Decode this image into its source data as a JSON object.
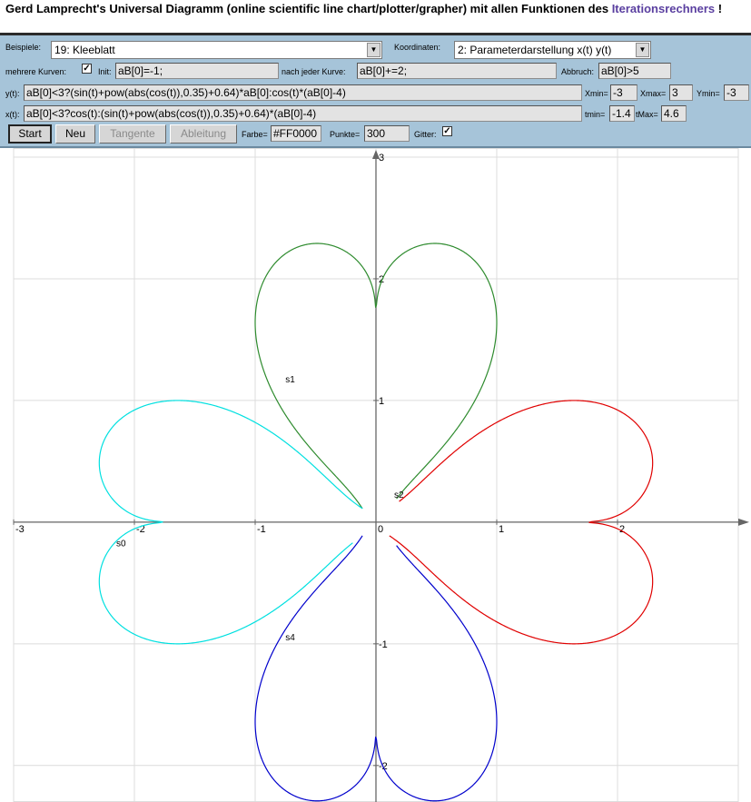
{
  "title": {
    "text": "Gerd Lamprecht's Universal Diagramm (online scientific line chart/plotter/grapher) mit allen Funktionen des ",
    "link": "Iterationsrechners",
    "suffix": " !"
  },
  "controls": {
    "examples_label": "Beispiele:",
    "examples_selected": "19: Kleeblatt",
    "coords_label": "Koordinaten:",
    "coords_selected": "2: Parameterdarstellung x(t) y(t)",
    "multi_label": "mehrere Kurven:",
    "multi_checked": "✓",
    "init_label": "Init:",
    "init_value": "aB[0]=-1;",
    "after_label": "nach jeder Kurve:",
    "after_value": "aB[0]+=2;",
    "abort_label": "Abbruch:",
    "abort_value": "aB[0]>5",
    "y_label": "y(t):",
    "y_value": "aB[0]<3?(sin(t)+pow(abs(cos(t)),0.35)+0.64)*aB[0]:cos(t)*(aB[0]-4)",
    "x_label": "x(t):",
    "x_value": "aB[0]<3?cos(t):(sin(t)+pow(abs(cos(t)),0.35)+0.64)*(aB[0]-4)",
    "xmin_label": "Xmin=",
    "xmin_value": "-3",
    "xmax_label": "Xmax=",
    "xmax_value": "3",
    "ymin_label": "Ymin=",
    "ymin_value": "-3",
    "tmin_label": "tmin=",
    "tmin_value": "-1.4",
    "tmax_label": "tMax=",
    "tmax_value": "4.6",
    "start_button": "Start",
    "new_button": "Neu",
    "tangent_button": "Tangente",
    "derivative_button": "Ableitung",
    "color_label": "Farbe=",
    "color_value": "#FF0000",
    "points_label": "Punkte=",
    "points_value": "300",
    "grid_label": "Gitter:",
    "grid_checked": "✓"
  },
  "chart_data": {
    "type": "line",
    "xlim": [
      -3,
      3
    ],
    "ylim": [
      -2.3,
      3
    ],
    "grid": true,
    "x_ticks": [
      "-3",
      "-2",
      "-1",
      "0",
      "1",
      "2"
    ],
    "x_tick_values": [
      -3,
      -2,
      -1,
      0,
      1,
      2
    ],
    "y_ticks": [
      "-2",
      "-1",
      "1",
      "2",
      "3"
    ],
    "y_tick_values": [
      -2,
      -1,
      1,
      2,
      3
    ],
    "t_range": [
      -1.4,
      4.6
    ],
    "points": 300,
    "series": [
      {
        "label": "s0",
        "k": -1,
        "color": "#0000CC",
        "label_at": [
          -2.15,
          -0.2
        ]
      },
      {
        "label": "s1",
        "k": 1,
        "color": "#2E8B2E",
        "label_at": [
          -0.75,
          1.15
        ]
      },
      {
        "label": "s2",
        "k": 3,
        "color": "#00E0E0",
        "label_at": [
          0.15,
          0.2
        ]
      },
      {
        "label": "s4",
        "k": 5,
        "color": "#E00000",
        "label_at": [
          -0.75,
          -0.97
        ]
      }
    ]
  }
}
